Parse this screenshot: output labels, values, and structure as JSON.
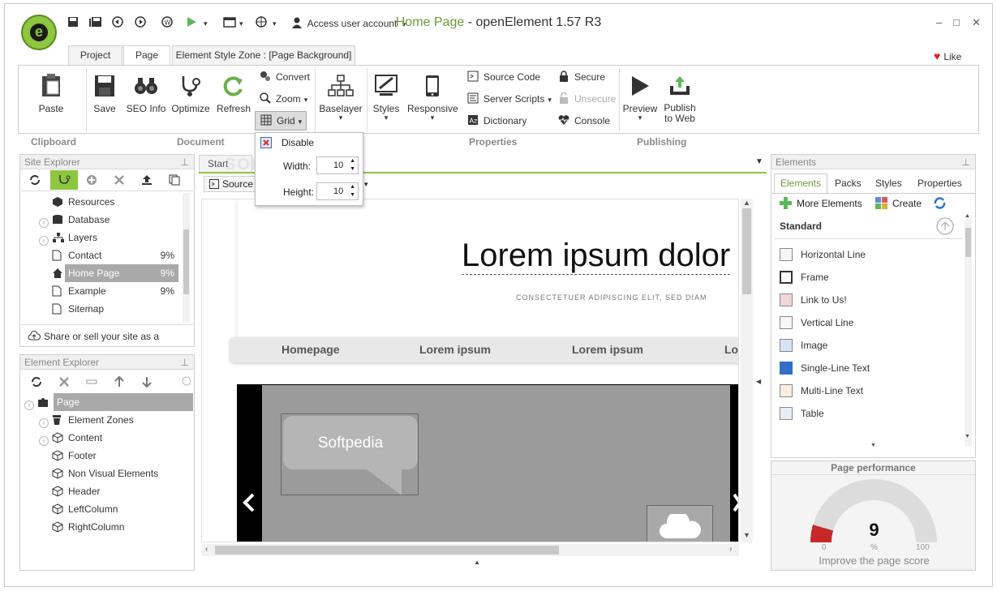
{
  "window": {
    "title_page": "Home Page",
    "title_app": " - openElement 1.57 R3",
    "user_account": "Access user account",
    "controls": {
      "minimize": "–",
      "maximize": "□",
      "close": "✕"
    }
  },
  "tabs": [
    {
      "label": "Project"
    },
    {
      "label": "Page"
    },
    {
      "label": "Element Style Zone : [Page Background]"
    }
  ],
  "like": "Like",
  "ribbon": {
    "paste": "Paste",
    "save": "Save",
    "seo": "SEO Info",
    "optimize": "Optimize",
    "refresh": "Refresh",
    "convert": "Convert",
    "zoom": "Zoom",
    "grid": "Grid",
    "baselayer": "Baselayer",
    "styles": "Styles",
    "responsive": "Responsive",
    "source_code": "Source Code",
    "server_scripts": "Server Scripts",
    "dictionary": "Dictionary",
    "secure": "Secure",
    "unsecure": "Unsecure",
    "console": "Console",
    "preview": "Preview",
    "publish_1": "Publish",
    "publish_2": "to Web",
    "groups": {
      "clipboard": "Clipboard",
      "document": "Document",
      "properties": "Properties",
      "publishing": "Publishing"
    }
  },
  "grid_menu": {
    "disable": "Disable",
    "width_label": "Width:",
    "width_value": "10",
    "height_label": "Height:",
    "height_value": "10"
  },
  "site_explorer": {
    "title": "Site Explorer",
    "items": [
      {
        "label": "Resources",
        "pct": ""
      },
      {
        "label": "Database",
        "pct": ""
      },
      {
        "label": "Layers",
        "pct": ""
      },
      {
        "label": "Contact",
        "pct": "9%"
      },
      {
        "label": "Home Page",
        "pct": "9%"
      },
      {
        "label": "Example",
        "pct": "9%"
      },
      {
        "label": "Sitemap",
        "pct": ""
      }
    ],
    "share": "Share or sell your site as a template"
  },
  "element_explorer": {
    "title": "Element Explorer",
    "items": [
      {
        "label": "Page"
      },
      {
        "label": "Element Zones"
      },
      {
        "label": "Content"
      },
      {
        "label": "Footer"
      },
      {
        "label": "Non Visual Elements"
      },
      {
        "label": "Header"
      },
      {
        "label": "LeftColumn"
      },
      {
        "label": "RightColumn"
      }
    ]
  },
  "canvas": {
    "start_tab": "Start",
    "source_btn": "Source",
    "heading": "Lorem ipsum dolor",
    "subheading": "CONSECTETUER ADIPISCING ELIT, SED DIAM",
    "nav": [
      "Homepage",
      "Lorem ipsum",
      "Lorem ipsum",
      "Lo"
    ],
    "bubble": "Softpedia",
    "watermark": "SOFTPEDIA"
  },
  "elements_panel": {
    "title": "Elements",
    "tabs": [
      "Elements",
      "Packs",
      "Styles",
      "Properties"
    ],
    "more": "More Elements",
    "create": "Create",
    "section": "Standard",
    "items": [
      {
        "label": "Horizontal Line"
      },
      {
        "label": "Frame"
      },
      {
        "label": "Link to Us!"
      },
      {
        "label": "Vertical Line"
      },
      {
        "label": "Image"
      },
      {
        "label": "Single-Line Text"
      },
      {
        "label": "Multi-Line Text"
      },
      {
        "label": "Table"
      }
    ]
  },
  "performance": {
    "title": "Page performance",
    "score": "9",
    "min": "0",
    "unit": "%",
    "max": "100",
    "hint": "Improve the page score",
    "value_fraction": 0.09
  },
  "colors": {
    "accent": "#8dc63f",
    "gauge_fill": "#c62828"
  }
}
